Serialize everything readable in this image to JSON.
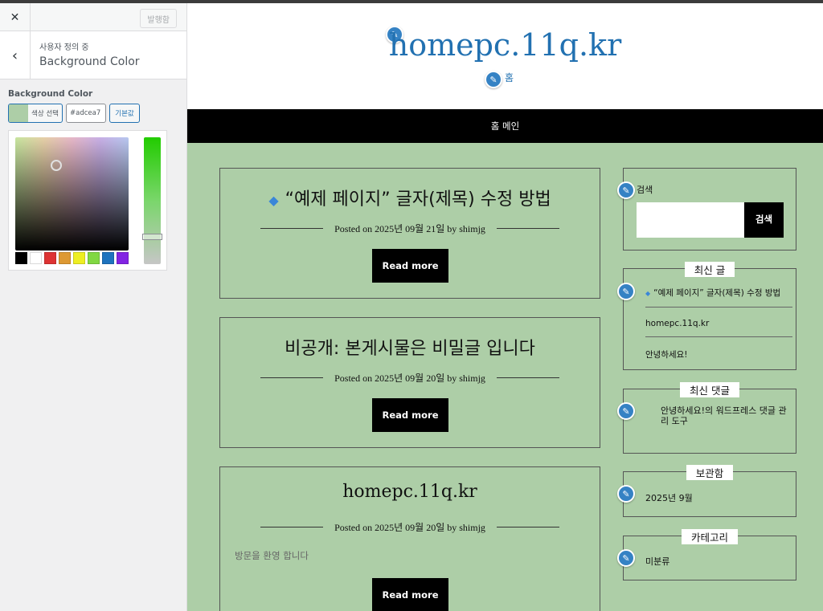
{
  "sidebar": {
    "close_glyph": "✕",
    "publish_label": "발행함",
    "back_glyph": "‹",
    "breadcrumb": "사용자 정의 중",
    "section_title": "Background Color",
    "control_label": "Background Color",
    "select_color_label": "색상 선택",
    "hex_value": "#adcea7",
    "default_label": "기본값",
    "selected_color": "#adcea7",
    "palette": [
      "#000000",
      "#ffffff",
      "#dd3333",
      "#dd9933",
      "#eeee22",
      "#81d742",
      "#1e73be",
      "#8224e3"
    ]
  },
  "preview": {
    "site_title": "homepc.11q.kr",
    "site_description": "홈",
    "nav_items": [
      "홈 메인"
    ],
    "posts": [
      {
        "title": "“예제 페이지” 글자(제목) 수정 방법",
        "has_diamond": true,
        "meta": "Posted on 2025년 09월 21일 by shimjg",
        "excerpt": "",
        "button": "Read more"
      },
      {
        "title": "비공개: 본게시물은 비밀글 입니다",
        "has_diamond": false,
        "meta": "Posted on 2025년 09월 20일 by shimjg",
        "excerpt": "",
        "button": "Read more"
      },
      {
        "title": "homepc.11q.kr",
        "has_diamond": false,
        "meta": "Posted on 2025년 09월 20일 by shimjg",
        "excerpt": "방문을 환영 합니다",
        "button": "Read more"
      }
    ],
    "widgets": {
      "search": {
        "label": "검색",
        "button": "검색"
      },
      "recent_posts": {
        "title": "최신 글",
        "items": [
          "“예제 페이지” 글자(제목) 수정 방법",
          "homepc.11q.kr",
          "안녕하세요!"
        ]
      },
      "recent_comments": {
        "title": "최신 댓글",
        "text": "안녕하세요!의 워드프레스 댓글 관리 도구"
      },
      "archives": {
        "title": "보관함",
        "item": "2025년 9월"
      },
      "categories": {
        "title": "카테고리",
        "item": "미분류"
      }
    },
    "background_color": "#adcea7",
    "link_color": "#2271b1"
  }
}
